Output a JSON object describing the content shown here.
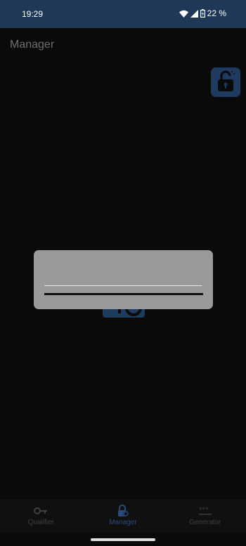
{
  "status_bar": {
    "time": "19:29",
    "battery": "22 %"
  },
  "header": {
    "title": "Manager"
  },
  "icons": {
    "lock": "unlock-icon",
    "key": "key-icon",
    "lock_nav": "lock-icon",
    "generator": "password-dots-icon"
  },
  "colors": {
    "status_bar": "#1f3857",
    "accent": "#1e3a5f",
    "dialog": "#9a9a9a",
    "background": "#0a0a0a"
  },
  "nav": {
    "items": [
      {
        "label": "Qualifier",
        "icon": "key-icon"
      },
      {
        "label": "Manager",
        "icon": "lock-icon"
      },
      {
        "label": "Generator",
        "icon": "password-dots-icon"
      }
    ]
  }
}
